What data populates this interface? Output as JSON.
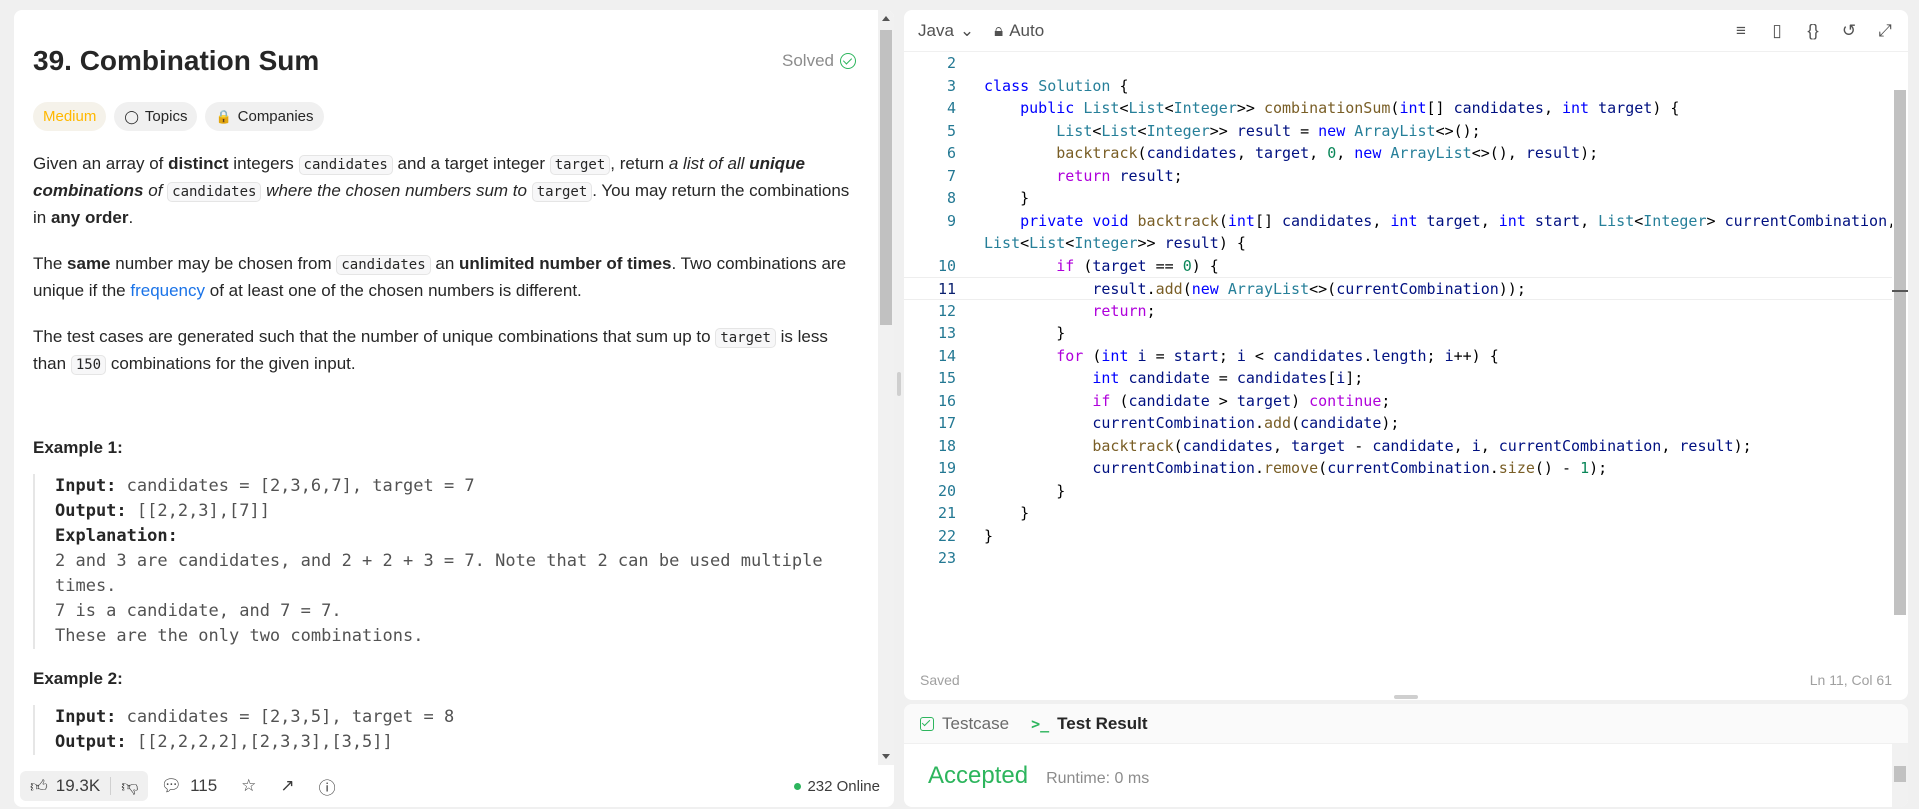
{
  "problem": {
    "title": "39. Combination Sum",
    "status": "Solved",
    "tags": {
      "difficulty": "Medium",
      "topics": "Topics",
      "companies": "Companies"
    },
    "p1": {
      "a": "Given an array of ",
      "b": "distinct",
      "c": " integers ",
      "d": "candidates",
      "e": " and a target integer ",
      "f": "target",
      "g": ", return ",
      "h": "a list of all ",
      "i": "unique combinations",
      "j": " of ",
      "k": "candidates",
      "l": " where the chosen numbers sum to ",
      "m": "target",
      "n": ". You may return the combinations in ",
      "o": "any order",
      "p": "."
    },
    "p2": {
      "a": "The ",
      "b": "same",
      "c": " number may be chosen from ",
      "d": "candidates",
      "e": " an ",
      "f": "unlimited number of times",
      "g": ". Two combinations are unique if the ",
      "h": "frequency",
      "i": " of at least one of the chosen numbers is different."
    },
    "p3": {
      "a": "The test cases are generated such that the number of unique combinations that sum up to ",
      "b": "target",
      "c": " is less than ",
      "d": "150",
      "e": " combinations for the given input."
    },
    "example1": {
      "title": "Example 1:",
      "input_label": "Input:",
      "input": " candidates = [2,3,6,7], target = 7",
      "output_label": "Output:",
      "output": " [[2,2,3],[7]]",
      "explanation_label": "Explanation:",
      "exp1": "2 and 3 are candidates, and 2 + 2 + 3 = 7. Note that 2 can be used multiple",
      "exp2": "times.",
      "exp3": "7 is a candidate, and 7 = 7.",
      "exp4": "These are the only two combinations."
    },
    "example2": {
      "title": "Example 2:",
      "input_label": "Input:",
      "input": " candidates = [2,3,5], target = 8",
      "output_label": "Output:",
      "output": " [[2,2,2,2],[2,3,3],[3,5]]"
    }
  },
  "bottom_bar": {
    "likes": "19.3K",
    "comments": "115",
    "online": "232 Online"
  },
  "editor": {
    "language": "Java",
    "mode": "Auto",
    "status": "Saved",
    "cursor": "Ln 11, Col 61",
    "line_numbers": [
      "2",
      "3",
      "4",
      "5",
      "6",
      "7",
      "8",
      "9",
      "",
      "10",
      "11",
      "12",
      "13",
      "14",
      "15",
      "16",
      "17",
      "18",
      "19",
      "20",
      "21",
      "22",
      "23"
    ],
    "current_line": "11"
  },
  "result": {
    "tab_testcase": "Testcase",
    "tab_result": "Test Result",
    "verdict": "Accepted",
    "runtime": "Runtime: 0 ms"
  },
  "colors": {
    "accepted": "#2db55d",
    "medium": "#ffb800",
    "link": "#1a73e8"
  }
}
